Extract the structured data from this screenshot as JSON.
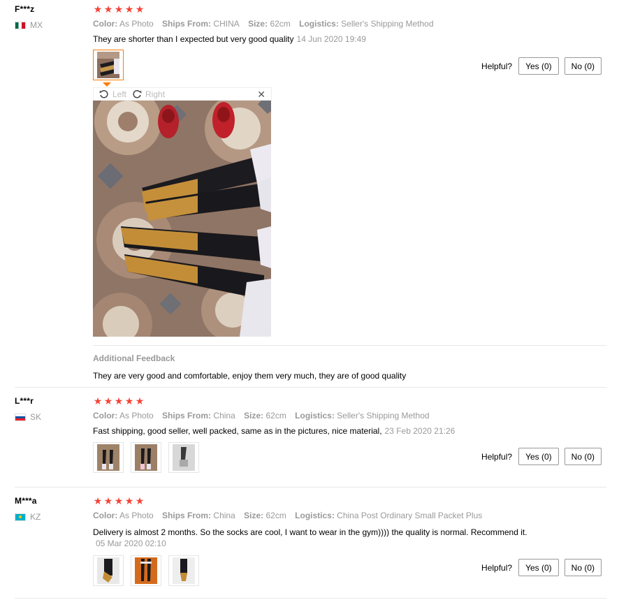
{
  "labels": {
    "color": "Color:",
    "ships_from": "Ships From:",
    "size": "Size:",
    "logistics": "Logistics:",
    "helpful": "Helpful?",
    "additional_feedback": "Additional Feedback",
    "rotate_left": "Left",
    "rotate_right": "Right"
  },
  "reviews": [
    {
      "user": "F***z",
      "country": "MX",
      "rating": 5,
      "color": "As Photo",
      "ships_from": "CHINA",
      "size": "62cm",
      "logistics": "Seller's Shipping Method",
      "text": "They are shorter than I expected but very good quality",
      "date": "14 Jun 2020 19:49",
      "yes": "Yes (0)",
      "no": "No (0)",
      "additional_feedback": "They are very good and comfortable, enjoy them very much, they are of good quality",
      "photos": [
        "photo-1"
      ]
    },
    {
      "user": "L***r",
      "country": "SK",
      "rating": 5,
      "color": "As Photo",
      "ships_from": "China",
      "size": "62cm",
      "logistics": "Seller's Shipping Method",
      "text": "Fast shipping, good seller, well packed, same as in the pictures, nice material,",
      "date": "23 Feb 2020 21:26",
      "yes": "Yes (0)",
      "no": "No (0)",
      "photos": [
        "photo-1",
        "photo-2",
        "photo-3"
      ]
    },
    {
      "user": "M***a",
      "country": "KZ",
      "rating": 5,
      "color": "As Photo",
      "ships_from": "China",
      "size": "62cm",
      "logistics": "China Post Ordinary Small Packet Plus",
      "text": "Delivery is almost 2 months. So the socks are cool, I want to wear in the gym)))) the quality is normal. Recommend it.",
      "date": "05 Mar 2020 02:10",
      "yes": "Yes (0)",
      "no": "No (0)",
      "photos": [
        "photo-1",
        "photo-2",
        "photo-3"
      ]
    }
  ],
  "colors": {
    "star": "#f44336",
    "muted": "#999999",
    "active_thumb": "#ff7a00",
    "divider": "#e8e8e8"
  }
}
